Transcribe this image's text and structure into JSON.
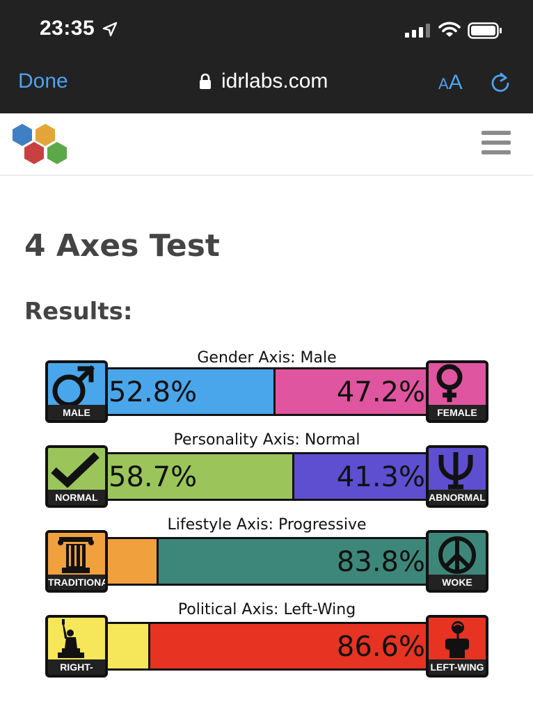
{
  "status": {
    "time": "23:35"
  },
  "browser": {
    "done_label": "Done",
    "url": "idrlabs.com",
    "text_size_small": "A",
    "text_size_big": "A"
  },
  "page": {
    "title": "4 Axes Test",
    "results_heading": "Results:"
  },
  "colors": {
    "male": "#4aa6ea",
    "female": "#e0559f",
    "normal": "#9bc55b",
    "abnormal": "#5d4fcf",
    "traditional": "#f0a03d",
    "woke": "#3d877a",
    "rightwing": "#f6e65a",
    "leftwing": "#e63322",
    "accent": "#4da3f0"
  },
  "axes": [
    {
      "label": "Gender Axis: Male",
      "left_cap": "MALE",
      "right_cap": "FEMALE",
      "left_pct": "52.8%",
      "right_pct": "47.2%",
      "left_value": 52.8,
      "right_value": 47.2,
      "left_icon": "male-symbol-icon",
      "right_icon": "female-symbol-icon"
    },
    {
      "label": "Personality Axis: Normal",
      "left_cap": "NORMAL",
      "right_cap": "ABNORMAL",
      "left_pct": "58.7%",
      "right_pct": "41.3%",
      "left_value": 58.7,
      "right_value": 41.3,
      "left_icon": "checkmark-icon",
      "right_icon": "psi-icon"
    },
    {
      "label": "Lifestyle Axis: Progressive",
      "left_cap": "TRADITIONAL",
      "right_cap": "WOKE",
      "left_pct": "",
      "right_pct": "83.8%",
      "left_value": 16.2,
      "right_value": 83.8,
      "left_icon": "column-icon",
      "right_icon": "peace-icon"
    },
    {
      "label": "Political Axis: Left-Wing",
      "left_cap": "RIGHT-WING",
      "right_cap": "LEFT-WING",
      "left_pct": "",
      "right_pct": "86.6%",
      "left_value": 13.4,
      "right_value": 86.6,
      "left_icon": "statue-of-liberty-icon",
      "right_icon": "fist-rose-icon"
    }
  ]
}
